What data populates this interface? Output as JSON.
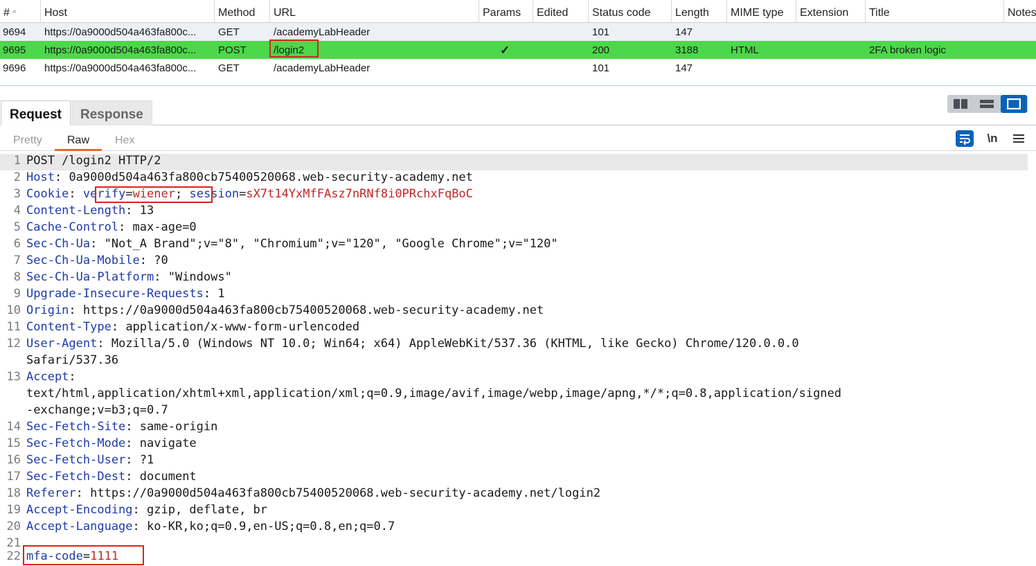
{
  "history": {
    "columns": [
      "#",
      "Host",
      "Method",
      "URL",
      "Params",
      "Edited",
      "Status code",
      "Length",
      "MIME type",
      "Extension",
      "Title",
      "Notes"
    ],
    "sort_indicator": "^",
    "rows": [
      {
        "num": "9694",
        "host": "https://0a9000d504a463fa800c...",
        "method": "GET",
        "url": "/academyLabHeader",
        "params": "",
        "edited": "",
        "status": "101",
        "length": "147",
        "mime": "",
        "extension": "",
        "title": "",
        "notes": ""
      },
      {
        "num": "9695",
        "host": "https://0a9000d504a463fa800c...",
        "method": "POST",
        "url": "/login2",
        "params": "✓",
        "edited": "",
        "status": "200",
        "length": "3188",
        "mime": "HTML",
        "extension": "",
        "title": "2FA broken logic",
        "notes": ""
      },
      {
        "num": "9696",
        "host": "https://0a9000d504a463fa800c...",
        "method": "GET",
        "url": "/academyLabHeader",
        "params": "",
        "edited": "",
        "status": "101",
        "length": "147",
        "mime": "",
        "extension": "",
        "title": "",
        "notes": ""
      }
    ]
  },
  "tabs": {
    "request": "Request",
    "response": "Response"
  },
  "subtabs": {
    "pretty": "Pretty",
    "raw": "Raw",
    "hex": "Hex"
  },
  "toolbar": {
    "newline_label": "\\n"
  },
  "request_lines": [
    {
      "n": "1",
      "name": "",
      "value": "POST /login2 HTTP/2"
    },
    {
      "n": "2",
      "name": "Host",
      "value": " 0a9000d504a463fa800cb75400520068.web-security-academy.net"
    },
    {
      "n": "3",
      "name": "Cookie",
      "cookie1_name": "verify",
      "cookie1_value": "wiener",
      "cookie2_name": "session",
      "cookie2_value": "sX7t14YxMfFAsz7nRNf8i0PRchxFqBoC"
    },
    {
      "n": "4",
      "name": "Content-Length",
      "value": " 13"
    },
    {
      "n": "5",
      "name": "Cache-Control",
      "value": " max-age=0"
    },
    {
      "n": "6",
      "name": "Sec-Ch-Ua",
      "value": " \"Not_A Brand\";v=\"8\", \"Chromium\";v=\"120\", \"Google Chrome\";v=\"120\""
    },
    {
      "n": "7",
      "name": "Sec-Ch-Ua-Mobile",
      "value": " ?0"
    },
    {
      "n": "8",
      "name": "Sec-Ch-Ua-Platform",
      "value": " \"Windows\""
    },
    {
      "n": "9",
      "name": "Upgrade-Insecure-Requests",
      "value": " 1"
    },
    {
      "n": "10",
      "name": "Origin",
      "value": " https://0a9000d504a463fa800cb75400520068.web-security-academy.net"
    },
    {
      "n": "11",
      "name": "Content-Type",
      "value": " application/x-www-form-urlencoded"
    },
    {
      "n": "12",
      "name": "User-Agent",
      "value": " Mozilla/5.0 (Windows NT 10.0; Win64; x64) AppleWebKit/537.36 (KHTML, like Gecko) Chrome/120.0.0.0",
      "cont": "Safari/537.36"
    },
    {
      "n": "13",
      "name": "Accept",
      "value": "",
      "cont": "text/html,application/xhtml+xml,application/xml;q=0.9,image/avif,image/webp,image/apng,*/*;q=0.8,application/signed",
      "cont2": "-exchange;v=b3;q=0.7"
    },
    {
      "n": "14",
      "name": "Sec-Fetch-Site",
      "value": " same-origin"
    },
    {
      "n": "15",
      "name": "Sec-Fetch-Mode",
      "value": " navigate"
    },
    {
      "n": "16",
      "name": "Sec-Fetch-User",
      "value": " ?1"
    },
    {
      "n": "17",
      "name": "Sec-Fetch-Dest",
      "value": " document"
    },
    {
      "n": "18",
      "name": "Referer",
      "value": " https://0a9000d504a463fa800cb75400520068.web-security-academy.net/login2"
    },
    {
      "n": "19",
      "name": "Accept-Encoding",
      "value": " gzip, deflate, br"
    },
    {
      "n": "20",
      "name": "Accept-Language",
      "value": " ko-KR,ko;q=0.9,en-US;q=0.8,en;q=0.7"
    },
    {
      "n": "21",
      "name": "",
      "value": ""
    },
    {
      "n": "22",
      "body_name": "mfa-code",
      "body_value": "1111"
    }
  ],
  "colors": {
    "selected_row": "#4cd84a",
    "highlight_box": "#d6261c",
    "header_name": "#1f3ba8",
    "cookie_value": "#c0282a",
    "accent_tab": "#e36b2c",
    "active_button": "#0a62b8"
  }
}
